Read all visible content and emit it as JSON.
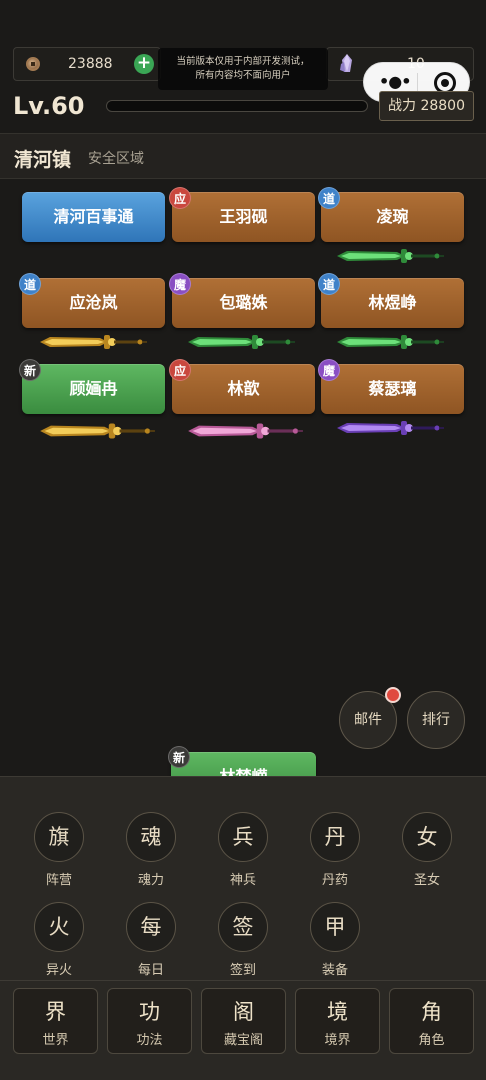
{
  "resources": {
    "coins": {
      "icon": "coin-icon",
      "value": "23888"
    },
    "crystals": {
      "icon": "crystal-icon",
      "value": "10"
    }
  },
  "notice": {
    "line1": "当前版本仅用于内部开发测试，",
    "line2": "所有内容均不面向用户"
  },
  "player": {
    "level": "Lv.60",
    "xp_progress": 0.0,
    "power_label": "战力 28800"
  },
  "location": {
    "name": "清河镇",
    "zone": "安全区域"
  },
  "npcs": [
    {
      "name": "清河百事通",
      "badge": "",
      "style": "blue",
      "weapon": ""
    },
    {
      "name": "王羽砚",
      "badge": "应",
      "style": "orange",
      "weapon": ""
    },
    {
      "name": "凌琬",
      "badge": "道",
      "style": "orange",
      "weapon": "green"
    },
    {
      "name": "应沧岚",
      "badge": "道",
      "style": "orange",
      "weapon": "gold"
    },
    {
      "name": "包璐姝",
      "badge": "魔",
      "style": "orange",
      "weapon": "green"
    },
    {
      "name": "林煜峥",
      "badge": "道",
      "style": "orange",
      "weapon": "green"
    },
    {
      "name": "顾婳冉",
      "badge": "新",
      "style": "green",
      "weapon": "gold"
    },
    {
      "name": "林歆",
      "badge": "应",
      "style": "orange",
      "weapon": "pink"
    },
    {
      "name": "蔡瑟璃",
      "badge": "魔",
      "style": "orange",
      "weapon": "purple"
    }
  ],
  "side_buttons": {
    "mail": "邮件",
    "rank": "排行"
  },
  "featured_npc": {
    "name": "林梵嵘",
    "badge": "新"
  },
  "functions": [
    {
      "glyph": "旗",
      "label": "阵营"
    },
    {
      "glyph": "魂",
      "label": "魂力"
    },
    {
      "glyph": "兵",
      "label": "神兵"
    },
    {
      "glyph": "丹",
      "label": "丹药"
    },
    {
      "glyph": "女",
      "label": "圣女"
    },
    {
      "glyph": "火",
      "label": "异火"
    },
    {
      "glyph": "每",
      "label": "每日"
    },
    {
      "glyph": "签",
      "label": "签到"
    },
    {
      "glyph": "甲",
      "label": "装备"
    }
  ],
  "bottom_nav": [
    {
      "glyph": "界",
      "label": "世界"
    },
    {
      "glyph": "功",
      "label": "功法"
    },
    {
      "glyph": "阁",
      "label": "藏宝阁"
    },
    {
      "glyph": "境",
      "label": "境界"
    },
    {
      "glyph": "角",
      "label": "角色"
    }
  ],
  "colors": {
    "background": "#1b1a18",
    "npc_orange": "#a0622c",
    "npc_blue": "#3f8bcb",
    "npc_green": "#4ca251",
    "weapon_green": "#5fd86a",
    "weapon_gold": "#e8b93c",
    "weapon_pink": "#e88fc8",
    "weapon_purple": "#9a66e6"
  }
}
